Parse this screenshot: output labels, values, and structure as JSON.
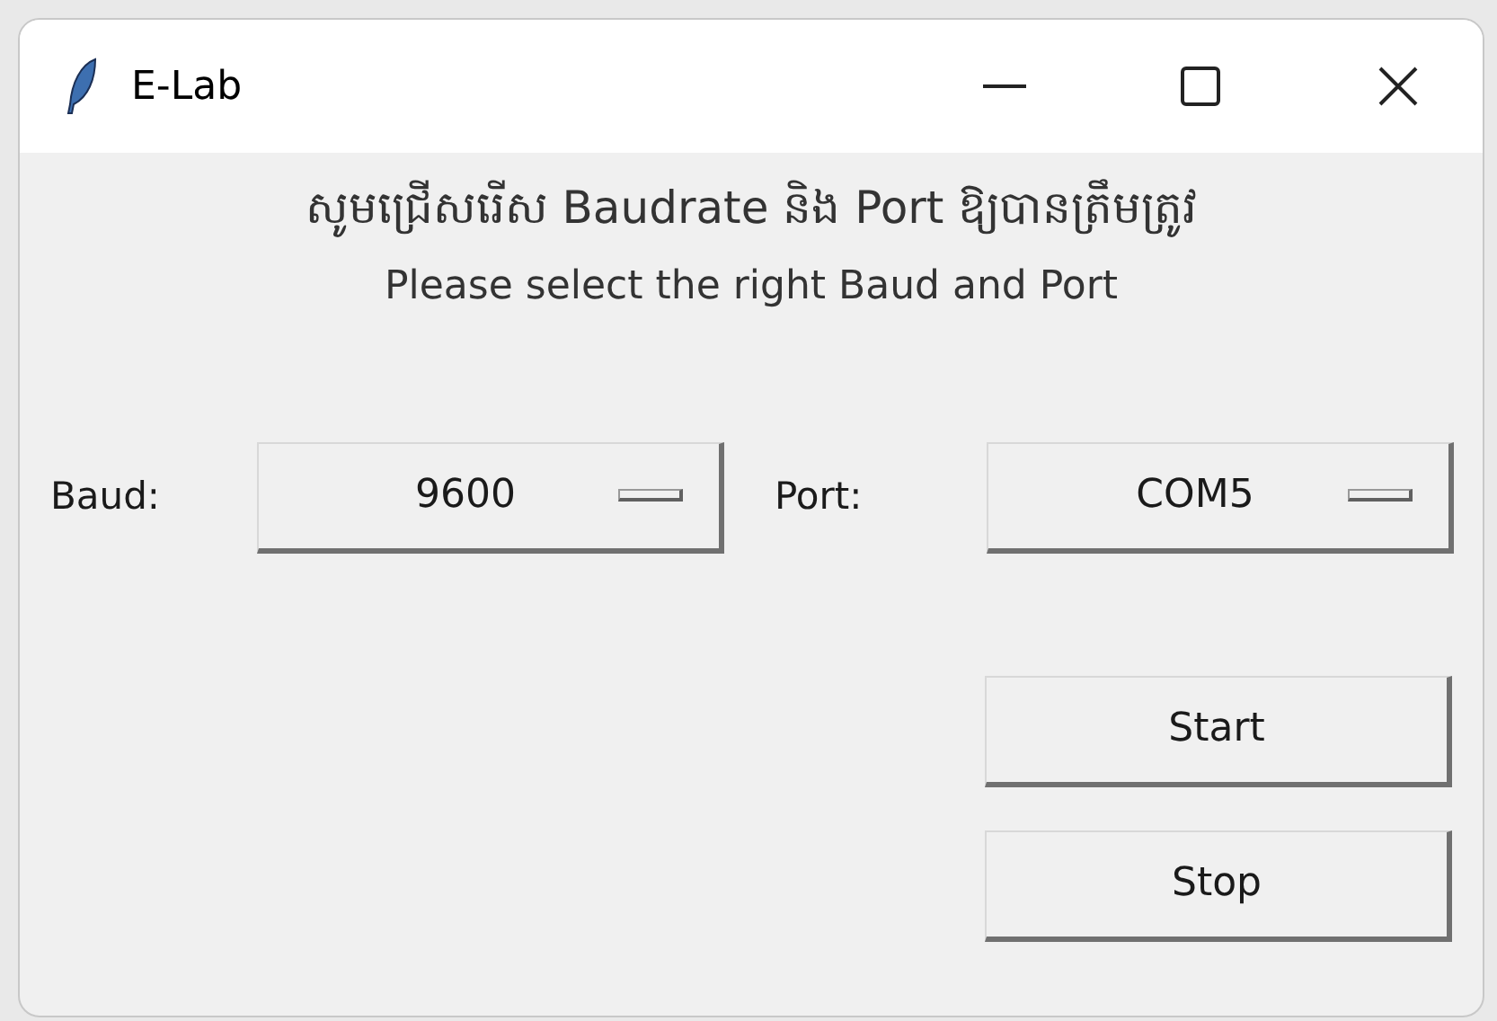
{
  "window": {
    "title": "E-Lab"
  },
  "heading_khmer": "សូមជ្រើសរើស Baudrate និង Port ឱ្យបានត្រឹមត្រូវ",
  "heading": "Please select the right Baud and Port",
  "fields": [
    {
      "label": "Baud:",
      "value": "9600"
    },
    {
      "label": "Port:",
      "value": "COM5"
    }
  ],
  "buttons": [
    "Start",
    "Stop"
  ]
}
